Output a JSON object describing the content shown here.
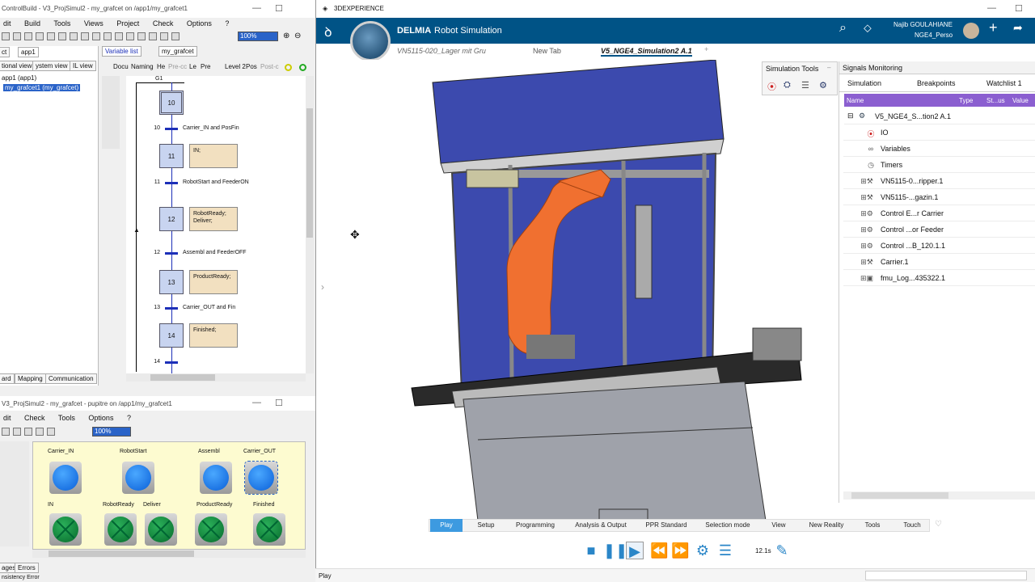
{
  "cb_main": {
    "title": "ControlBuild - V3_ProjSimul2 - my_grafcet on /app1/my_grafcet1",
    "menu": [
      "dit",
      "Build",
      "Tools",
      "Views",
      "Project",
      "Check",
      "Options",
      "?"
    ],
    "zoom": "100%",
    "left_tabs": [
      "ct",
      "app1"
    ],
    "left_tabs2": [
      "tional view",
      "ystem view",
      "IL view"
    ],
    "tree": [
      "app1 (app1)",
      "my_grafcet1 (my_grafcet)"
    ],
    "bottom_tabs": [
      "ard",
      "Mapping",
      "Communication"
    ],
    "view_tabs": [
      "Variable list",
      "my_grafcet"
    ],
    "doc_tabs": [
      "Docu",
      "Naming",
      "He",
      "Pre-cc",
      "Le",
      "Pre",
      "Level 2",
      "Pos",
      "Post-c"
    ],
    "g1": "G1"
  },
  "grafcet": {
    "steps": [
      {
        "num": "10",
        "action": ""
      },
      {
        "num": "11",
        "action": "IN;"
      },
      {
        "num": "12",
        "action": "RobotReady;\nDeliver;"
      },
      {
        "num": "13",
        "action": "ProductReady;"
      },
      {
        "num": "14",
        "action": "Finished;"
      }
    ],
    "transitions": [
      {
        "num": "10",
        "cond": "Carrier_IN and PosFin"
      },
      {
        "num": "11",
        "cond": "RobotStart and FeederON"
      },
      {
        "num": "12",
        "cond": "Assembl and FeederOFF"
      },
      {
        "num": "13",
        "cond": "Carrier_OUT and Fin"
      },
      {
        "num": "14",
        "cond": ""
      }
    ]
  },
  "pupitre": {
    "title": "V3_ProjSimul2 - my_grafcet - pupitre on /app1/my_grafcet1",
    "menu": [
      "dit",
      "Check",
      "Tools",
      "Options",
      "?"
    ],
    "zoom": "100%",
    "labels_top": [
      "Carrier_IN",
      "RobotStart",
      "Assembl",
      "Carrier_OUT"
    ],
    "labels_bottom": [
      "IN",
      "RobotReady",
      "Deliver",
      "ProductReady",
      "Finished"
    ],
    "bottom_tabs": [
      "ages",
      "Errors"
    ],
    "status": "nsistency Error"
  },
  "dx": {
    "app_title": "3DEXPERIENCE",
    "brand": "DELMIA",
    "app": "Robot Simulation",
    "user": "Najib GOULAHIANE",
    "workspace": "NGE4_Perso",
    "tabs": [
      "VN5115-020_Lager mit Gru",
      "New Tab",
      "V5_NGE4_Simulation2 A.1",
      "+"
    ],
    "sim_tools": "Simulation Tools",
    "signals": "Signals Monitoring",
    "panel_tabs": [
      "Simulation",
      "Breakpoints",
      "Watchlist 1"
    ],
    "columns": [
      "Name",
      "Type",
      "St...us",
      "Value"
    ],
    "root": "V5_NGE4_S...tion2 A.1",
    "tree": [
      {
        "label": "IO",
        "icon": "io-icon"
      },
      {
        "label": "Variables",
        "icon": "variables-icon"
      },
      {
        "label": "Timers",
        "icon": "timer-icon"
      },
      {
        "label": "VN5115-0...ripper.1",
        "icon": "robot-icon"
      },
      {
        "label": "VN5115-...gazin.1",
        "icon": "robot-icon"
      },
      {
        "label": "Control E...r Carrier",
        "icon": "control-icon"
      },
      {
        "label": "Control ...or Feeder",
        "icon": "control-icon"
      },
      {
        "label": "Control ...B_120.1.1",
        "icon": "control-icon"
      },
      {
        "label": "Carrier.1",
        "icon": "robot-icon"
      },
      {
        "label": "fmu_Log...435322.1",
        "icon": "fmu-icon"
      }
    ],
    "bottom_tabs": [
      "Play",
      "Setup",
      "Programming",
      "Analysis & Output",
      "PPR Standard",
      "Selection mode",
      "View",
      "New Reality",
      "Tools",
      "Touch"
    ],
    "time": "12.1s",
    "status": "Play"
  }
}
